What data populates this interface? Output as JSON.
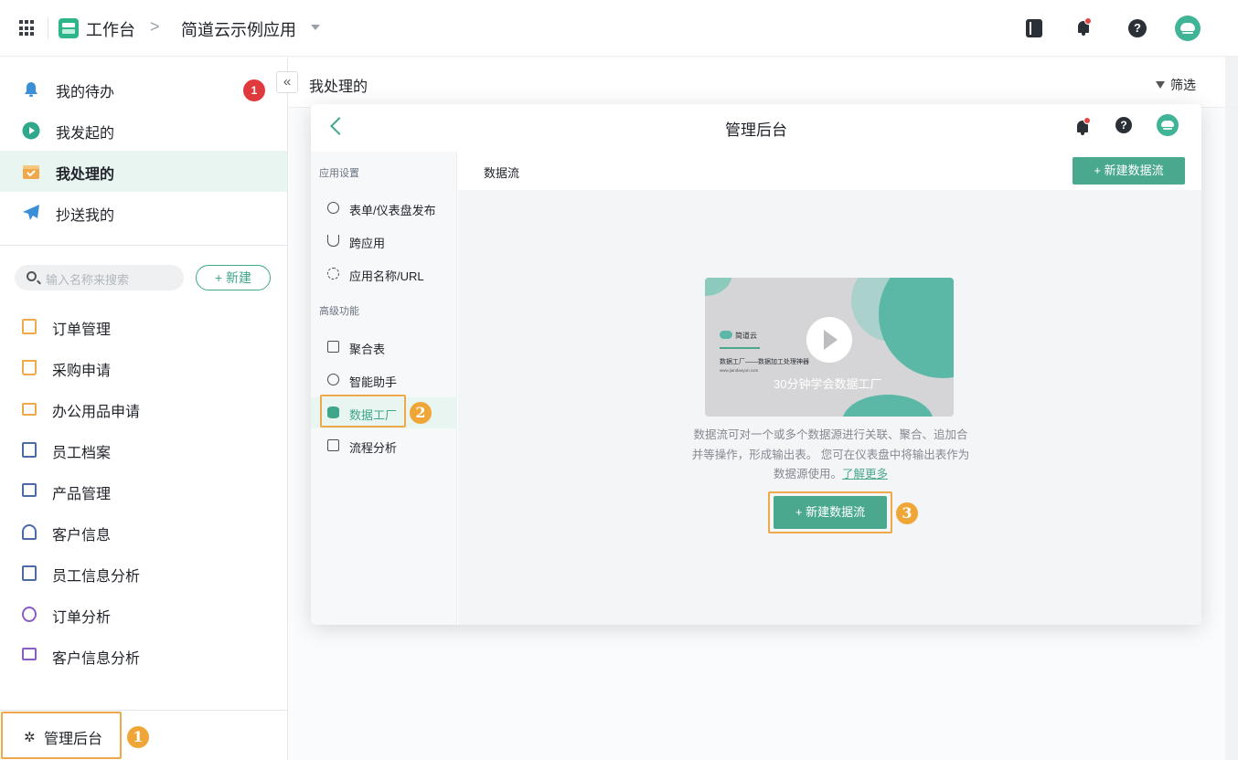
{
  "topbar": {
    "workspace": "工作台",
    "separator": ">",
    "app_name": "简道云示例应用"
  },
  "sidebar": {
    "nav": [
      {
        "label": "我的待办",
        "icon": "bell-icon",
        "badge": "1"
      },
      {
        "label": "我发起的",
        "icon": "play-circle-icon"
      },
      {
        "label": "我处理的",
        "icon": "inbox-check-icon",
        "active": true
      },
      {
        "label": "抄送我的",
        "icon": "paper-plane-icon"
      }
    ],
    "collapse": "«",
    "search_placeholder": "输入名称来搜索",
    "new_label": "+ 新建",
    "apps": [
      {
        "label": "订单管理",
        "color": "#f0a94a"
      },
      {
        "label": "采购申请",
        "color": "#f0a94a"
      },
      {
        "label": "办公用品申请",
        "color": "#f0a94a"
      },
      {
        "label": "员工档案",
        "color": "#4a6aa8"
      },
      {
        "label": "产品管理",
        "color": "#4a6aa8"
      },
      {
        "label": "客户信息",
        "color": "#4a6aa8"
      },
      {
        "label": "员工信息分析",
        "color": "#4a6aa8"
      },
      {
        "label": "订单分析",
        "color": "#8a5cc4"
      },
      {
        "label": "客户信息分析",
        "color": "#8a5cc4"
      }
    ],
    "admin_label": "管理后台",
    "step1": "1"
  },
  "content": {
    "title": "我处理的",
    "filter_label": "筛选"
  },
  "panel": {
    "back": "<",
    "title": "管理后台",
    "groups": [
      {
        "title": "应用设置",
        "items": [
          "表单/仪表盘发布",
          "跨应用",
          "应用名称/URL"
        ]
      },
      {
        "title": "高级功能",
        "items": [
          "聚合表",
          "智能助手",
          "数据工厂",
          "流程分析"
        ]
      }
    ],
    "active_item": "数据工厂",
    "step2": "2",
    "tab_label": "数据流",
    "new_flow_btn": "+ 新建数据流",
    "video": {
      "brand": "简道云",
      "subtitle": "数据工厂——数据加工处理神器",
      "url": "www.jiandaoyun.com",
      "title": "30分钟学会数据工厂"
    },
    "desc_line1": "数据流可对一个或多个数据源进行关联、聚合、追加合",
    "desc_line2": "并等操作，形成输出表。 您可在仪表盘中将输出表作为",
    "desc_line3": "数据源使用。",
    "learn_more": "了解更多",
    "cta_label": "+ 新建数据流",
    "step3": "3"
  },
  "colors": {
    "accent": "#3fa68a",
    "highlight": "#f0a94a",
    "badge": "#e0393e"
  }
}
